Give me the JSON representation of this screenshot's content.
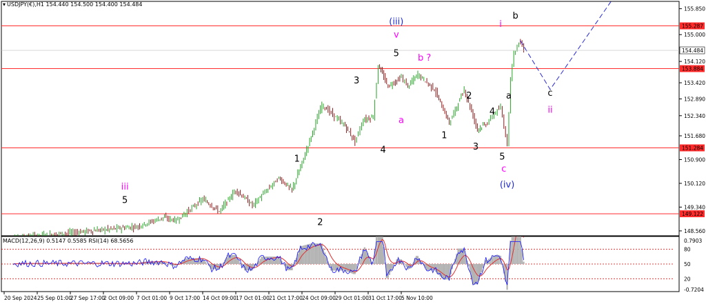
{
  "header": {
    "symbol_line": "USDJPY(€),H1  154.440 154.500 154.400 154.484",
    "dropdown_icon": "triangle-down-icon"
  },
  "indicator_header": "MACD(12,26,9) 0.5147 0.5585  RSI(14) 68.5656",
  "colors": {
    "bull_candle": "#26a626",
    "bear_candle": "#8b1a1a",
    "level_line": "#ff2a2a",
    "price_badge": "#ff2a2a",
    "current_price_badge": "#ffffff",
    "magenta_label": "#ff00ff",
    "blue_label": "#1e2bd6",
    "projection_line": "#2828d8",
    "macd_hist": "#b3b3b3",
    "macd_signal": "#e03030",
    "rsi_line": "#1010ff",
    "rsi_levels": "#cc0000"
  },
  "chart_data": [
    {
      "type": "line",
      "title": "USDJPY(€),H1",
      "x_ticks": [
        "20 Sep 2024",
        "25 Sep 01:00",
        "27 Sep 17:00",
        "2 Oct 09:00",
        "7 Oct 01:00",
        "9 Oct 17:00",
        "14 Oct 09:00",
        "17 Oct 01:00",
        "21 Oct 17:00",
        "24 Oct 09:00",
        "29 Oct 01:00",
        "31 Oct 17:00",
        "5 Nov 10:00"
      ],
      "y_ticks": [
        148.56,
        149.34,
        150.12,
        150.9,
        151.68,
        152.34,
        152.89,
        153.42,
        154.12,
        155.0,
        155.85
      ],
      "ylim": [
        148.4,
        156.0
      ],
      "current_price": "154.484",
      "level_lines": [
        {
          "value": 155.287,
          "label": "155.287"
        },
        {
          "value": 153.884,
          "label": "153.884"
        },
        {
          "value": 151.284,
          "label": "151.284"
        },
        {
          "value": 149.122,
          "label": "149.122"
        }
      ],
      "anchors": [
        [
          0,
          148.3
        ],
        [
          3,
          148.6
        ],
        [
          4,
          148.7
        ],
        [
          4.8,
          149.0
        ],
        [
          5.2,
          148.9
        ],
        [
          6,
          149.6
        ],
        [
          6.5,
          149.2
        ],
        [
          7,
          149.9
        ],
        [
          7.5,
          149.4
        ],
        [
          8.3,
          150.3
        ],
        [
          8.7,
          149.9
        ],
        [
          9,
          150.8
        ],
        [
          9.6,
          152.7
        ],
        [
          10.3,
          152.0
        ],
        [
          10.6,
          151.5
        ],
        [
          10.85,
          152.2
        ],
        [
          11.15,
          152.3
        ],
        [
          11.3,
          154.0
        ],
        [
          11.6,
          153.3
        ],
        [
          12.0,
          153.6
        ],
        [
          12.2,
          153.3
        ],
        [
          12.5,
          153.7
        ],
        [
          13.0,
          153.2
        ],
        [
          13.45,
          152.1
        ],
        [
          13.9,
          153.2
        ],
        [
          14.3,
          151.9
        ],
        [
          14.6,
          152.1
        ],
        [
          14.8,
          152.4
        ],
        [
          15.0,
          152.6
        ],
        [
          15.2,
          151.4
        ],
        [
          15.3,
          153.6
        ],
        [
          15.4,
          154.4
        ],
        [
          15.6,
          154.8
        ],
        [
          15.7,
          154.5
        ]
      ],
      "wave_labels": [
        {
          "text": "iii",
          "x": 3.65,
          "y": 149.92,
          "color": "magenta"
        },
        {
          "text": "5",
          "x": 3.65,
          "y": 149.48,
          "color": "black"
        },
        {
          "text": "1",
          "x": 8.85,
          "y": 150.83,
          "color": "black"
        },
        {
          "text": "2",
          "x": 9.55,
          "y": 148.75,
          "color": "black"
        },
        {
          "text": "3",
          "x": 10.65,
          "y": 153.4,
          "color": "black"
        },
        {
          "text": "4",
          "x": 11.45,
          "y": 151.12,
          "color": "black"
        },
        {
          "text": "(iii)",
          "x": 11.85,
          "y": 155.33,
          "color": "blue"
        },
        {
          "text": "v",
          "x": 11.85,
          "y": 154.9,
          "color": "magenta"
        },
        {
          "text": "5",
          "x": 11.85,
          "y": 154.29,
          "color": "black"
        },
        {
          "text": "a",
          "x": 12.0,
          "y": 152.1,
          "color": "magenta"
        },
        {
          "text": "b ?",
          "x": 12.7,
          "y": 154.15,
          "color": "magenta"
        },
        {
          "text": "2",
          "x": 14.05,
          "y": 152.9,
          "color": "black"
        },
        {
          "text": "1",
          "x": 13.3,
          "y": 151.6,
          "color": "black"
        },
        {
          "text": "3",
          "x": 14.25,
          "y": 151.23,
          "color": "black"
        },
        {
          "text": "4",
          "x": 14.75,
          "y": 152.38,
          "color": "black"
        },
        {
          "text": "5",
          "x": 15.05,
          "y": 150.9,
          "color": "black"
        },
        {
          "text": "c",
          "x": 15.1,
          "y": 150.5,
          "color": "magenta"
        },
        {
          "text": "(iv)",
          "x": 15.2,
          "y": 149.98,
          "color": "blue"
        },
        {
          "text": "i",
          "x": 15.0,
          "y": 155.25,
          "color": "magenta"
        },
        {
          "text": "b",
          "x": 15.45,
          "y": 155.52,
          "color": "black"
        },
        {
          "text": "a",
          "x": 15.25,
          "y": 152.9,
          "color": "black"
        },
        {
          "text": "c",
          "x": 16.5,
          "y": 152.99,
          "color": "black"
        },
        {
          "text": "ii",
          "x": 16.5,
          "y": 152.44,
          "color": "magenta"
        }
      ],
      "projection": [
        [
          15.6,
          154.8
        ],
        [
          16.5,
          153.2
        ],
        [
          18.6,
          156.5
        ]
      ]
    },
    {
      "type": "line",
      "title": "MACD(12,26,9) RSI(14)",
      "y_ticks_right": [
        "0.7903",
        "80",
        "50",
        "20",
        "-0.7204"
      ],
      "current_rsi": "68.5656",
      "rsi_levels": [
        80,
        50,
        20
      ]
    }
  ]
}
